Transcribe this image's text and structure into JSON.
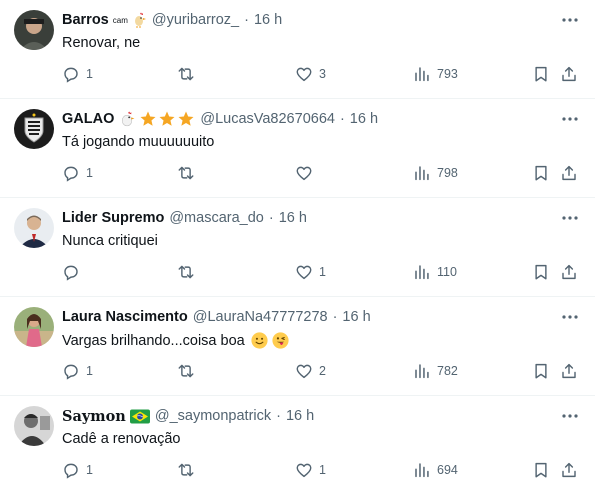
{
  "colors": {
    "text": "#0f1419",
    "muted": "#536471",
    "divider": "#eff3f4",
    "star": "#f5a623",
    "brazil_green": "#229e45",
    "brazil_yellow": "#f8e509"
  },
  "replies": [
    {
      "name": "Barros",
      "badge_text": "cam",
      "badge_icon": "rooster-icon",
      "handle": "@yuribarroz_",
      "dot": "·",
      "time": "16 h",
      "text": "Renovar, ne",
      "reply_count": "1",
      "retweet_count": "",
      "like_count": "3",
      "view_count": "793"
    },
    {
      "name": "GALAO",
      "badge_icon": "rooster-icon",
      "stars": 3,
      "handle": "@LucasVa82670664",
      "dot": "·",
      "time": "16 h",
      "text": "Tá jogando muuuuuuito",
      "reply_count": "1",
      "retweet_count": "",
      "like_count": "",
      "view_count": "798"
    },
    {
      "name": "Lider Supremo",
      "handle": "@mascara_do",
      "dot": "·",
      "time": "16 h",
      "text": "Nunca critiquei",
      "reply_count": "",
      "retweet_count": "",
      "like_count": "1",
      "view_count": "110"
    },
    {
      "name": "Laura Nascimento",
      "handle": "@LauraNa47777278",
      "dot": "·",
      "time": "16 h",
      "text": "Vargas brilhando...coisa boa",
      "emojis": [
        "slightly-smiling-face-icon",
        "winking-tongue-face-icon"
      ],
      "reply_count": "1",
      "retweet_count": "",
      "like_count": "2",
      "view_count": "782"
    },
    {
      "name": "Saymon",
      "badge_icon": "brazil-flag-icon",
      "handle": "@_saymonpatrick",
      "dot": "·",
      "time": "16 h",
      "text": "Cadê a renovação",
      "reply_count": "1",
      "retweet_count": "",
      "like_count": "1",
      "view_count": "694"
    }
  ]
}
